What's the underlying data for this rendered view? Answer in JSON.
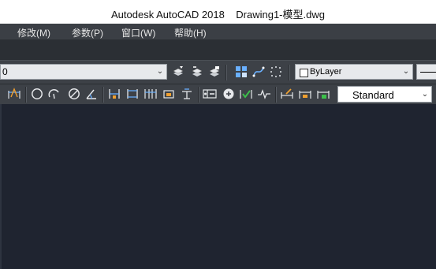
{
  "window": {
    "title": "Autodesk AutoCAD 2018    Drawing1-模型.dwg"
  },
  "menubar": {
    "items": [
      {
        "label": "修改(M)"
      },
      {
        "label": "参数(P)"
      },
      {
        "label": "窗口(W)"
      },
      {
        "label": "帮助(H)"
      }
    ]
  },
  "layers_toolbar": {
    "current_layer": "0",
    "color_value": "ByLayer"
  },
  "dimension_toolbar": {
    "dim_style": "Standard"
  },
  "icons": [
    "layer-state-icon",
    "layer-previous-icon",
    "layer-isolate-icon",
    "grid-icon",
    "spline-icon",
    "snap-icon",
    "quick-dimension-icon",
    "circle-icon",
    "arc-icon",
    "ellipse-icon",
    "angle-icon",
    "linear-dimension-icon",
    "aligned-dimension-icon",
    "continue-dimension-icon",
    "baseline-dimension-icon",
    "ordinate-dimension-icon",
    "tolerance-icon",
    "center-mark-icon",
    "inspect-icon",
    "jogged-linear-icon",
    "oblique-icon",
    "dimension-text-edit-icon",
    "dimension-update-icon"
  ],
  "colors": {
    "title_bg": "#ffffff",
    "menu_bg": "#3b3f45",
    "toolbar_bg": "#3d4147",
    "canvas_bg": "#1f2430",
    "icon_blue": "#6ab0ff",
    "icon_orange": "#f0a030",
    "icon_green": "#3cc04a"
  }
}
